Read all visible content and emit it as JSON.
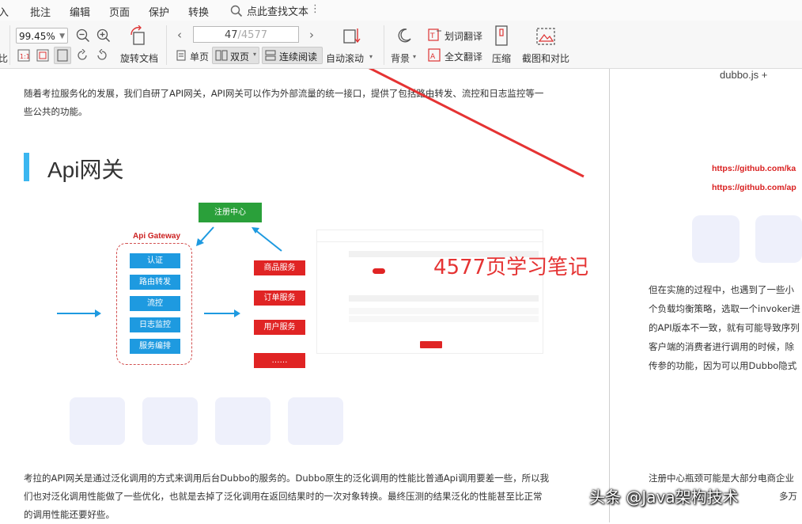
{
  "menu": {
    "items": [
      "入",
      "批注",
      "编辑",
      "页面",
      "保护",
      "转换"
    ],
    "search_label": "点此查找文本",
    "more_label": "⋮"
  },
  "toolbar": {
    "zoom_value": "99.45%",
    "rotate_label": "旋转文档",
    "page_current": "47",
    "page_total": "/4577",
    "single_label": "单页",
    "double_label": "双页",
    "continuous_label": "连续阅读",
    "autoscroll_label": "自动滚动",
    "background_label": "背景",
    "word_translate_label": "划词翻译",
    "full_translate_label": "全文翻译",
    "compress_label": "压缩",
    "screenshot_label": "截图和对比",
    "left_edge_label": "比"
  },
  "document": {
    "para1_line1": "随着考拉服务化的发展，我们自研了API网关，API网关可以作为外部流量的统一接口，提供了包括路由转发、流控和日志监控等一",
    "para1_line2": "些公共的功能。",
    "heading": "Api网关",
    "diagram": {
      "gateway_title": "Api Gateway",
      "registry": "注册中心",
      "gateway_items": [
        "认证",
        "路由转发",
        "流控",
        "日志监控",
        "服务编排"
      ],
      "services": [
        "商品服务",
        "订单服务",
        "用户服务",
        "……"
      ]
    },
    "para2_line1": "考拉的API网关是通过泛化调用的方式来调用后台Dubbo的服务的。Dubbo原生的泛化调用的性能比普通Api调用要差一些，所以我",
    "para2_line2": "们也对泛化调用性能做了一些优化，也就是去掉了泛化调用在返回结果时的一次对象转换。最终压测的结果泛化的性能甚至比正常",
    "para2_line3": "的调用性能还要好些。",
    "annotation": "4577页学习笔记",
    "right_page": {
      "logo": "dubbo.js    +",
      "link1": "https://github.com/ka",
      "link2": "https://github.com/ap",
      "lines": [
        "但在实施的过程中，也遇到了一些小",
        "个负载均衡策略，选取一个invoker进",
        "的API版本不一致，就有可能导致序列",
        "客户端的消费者进行调用的时候，除",
        "传参的功能，因为可以用Dubbo隐式"
      ],
      "bottom_line1": "注册中心瓶颈可能是大部分电商企业",
      "bottom_line2": "多万"
    },
    "watermark": "头条 @Java架构技术"
  },
  "colors": {
    "accent_blue": "#1e9ae0",
    "service_red": "#e02424",
    "registry_green": "#2aa03a",
    "annotation_red": "#e53333",
    "heading_bar": "#3bb6f0"
  }
}
